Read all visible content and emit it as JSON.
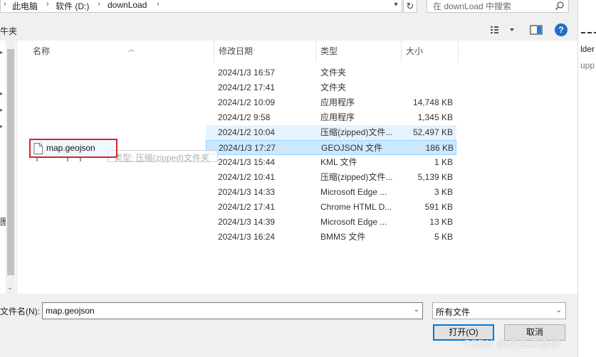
{
  "address_bar": {
    "crumbs": [
      "此电脑",
      "软件 (D:)",
      "downLoad"
    ]
  },
  "search": {
    "placeholder": "在 downLoad 中搜索"
  },
  "toolbar": {
    "new_folder_fragment": "牛夹"
  },
  "columns": {
    "name": "名称",
    "date": "修改日期",
    "type": "类型",
    "size": "大小"
  },
  "files": [
    {
      "date": "2024/1/3 16:57",
      "type": "文件夹",
      "size": ""
    },
    {
      "date": "2024/1/2 17:41",
      "type": "文件夹",
      "size": ""
    },
    {
      "date": "2024/1/2 10:09",
      "type": "应用程序",
      "size": "14,748 KB"
    },
    {
      "date": "2024/1/2 9:58",
      "type": "应用程序",
      "size": "1,345 KB"
    },
    {
      "date": "2024/1/2 10:04",
      "type": "压缩(zipped)文件...",
      "size": "52,497 KB",
      "state": "hover"
    },
    {
      "date": "2024/1/3 17:27",
      "type": "GEOJSON 文件",
      "size": "186 KB",
      "state": "selected"
    },
    {
      "date": "2024/1/3 15:44",
      "type": "KML 文件",
      "size": "1 KB"
    },
    {
      "date": "2024/1/2 10:41",
      "type": "压缩(zipped)文件...",
      "size": "5,139 KB"
    },
    {
      "date": "2024/1/3 14:33",
      "type": "Microsoft Edge ...",
      "size": "3 KB"
    },
    {
      "date": "2024/1/2 17:41",
      "type": "Chrome HTML D...",
      "size": "591 KB"
    },
    {
      "date": "2024/1/3 14:39",
      "type": "Microsoft Edge ...",
      "size": "13 KB"
    },
    {
      "date": "2024/1/3 16:24",
      "type": "BMMS 文件",
      "size": "5 KB"
    }
  ],
  "drag": {
    "file_name": "map.geojson",
    "tooltip": "类型: 压缩(zipped)文件夹"
  },
  "nav_fragment": "图",
  "background_fragments": [
    "lder",
    "upp"
  ],
  "filename": {
    "label": "文件名(N):",
    "value": "map.geojson"
  },
  "filetype": {
    "value": "所有文件"
  },
  "buttons": {
    "open": "打开(O)",
    "cancel": "取消"
  },
  "help_label": "?",
  "watermark": "CSDN @欢喜欢喜你",
  "colors": {
    "selection": "#cce8ff",
    "hover": "#e5f3ff",
    "highlight_box": "#d9242a",
    "accent": "#0078d7"
  }
}
